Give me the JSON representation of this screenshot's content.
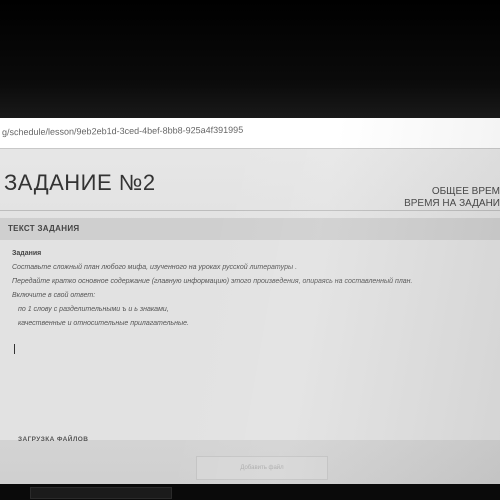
{
  "browser": {
    "url": "g/schedule/lesson/9eb2eb1d-3ced-4bef-8bb8-925a4f391995"
  },
  "header": {
    "title": "ЗАДАНИЕ №2",
    "total_time_label": "ОБЩЕЕ ВРЕМ",
    "task_time_label": "ВРЕМЯ НА ЗАДАНИ"
  },
  "task": {
    "section_title": "ТЕКСТ ЗАДАНИЯ",
    "label": "Задания",
    "lines": [
      "Составьте сложный план любого мифа, изученного на уроках русской литературы .",
      "Передайте кратко основное содержание (главную информацию) этого произведения, опираясь на составленный план.",
      "Включите в свой ответ:",
      "по 1 слову с разделительными ъ и ь знаками,",
      "качественные и относительные прилагательные."
    ]
  },
  "upload": {
    "label": "ЗАГРУЗКА ФАЙЛОВ",
    "button_label": "Добавить файл"
  }
}
